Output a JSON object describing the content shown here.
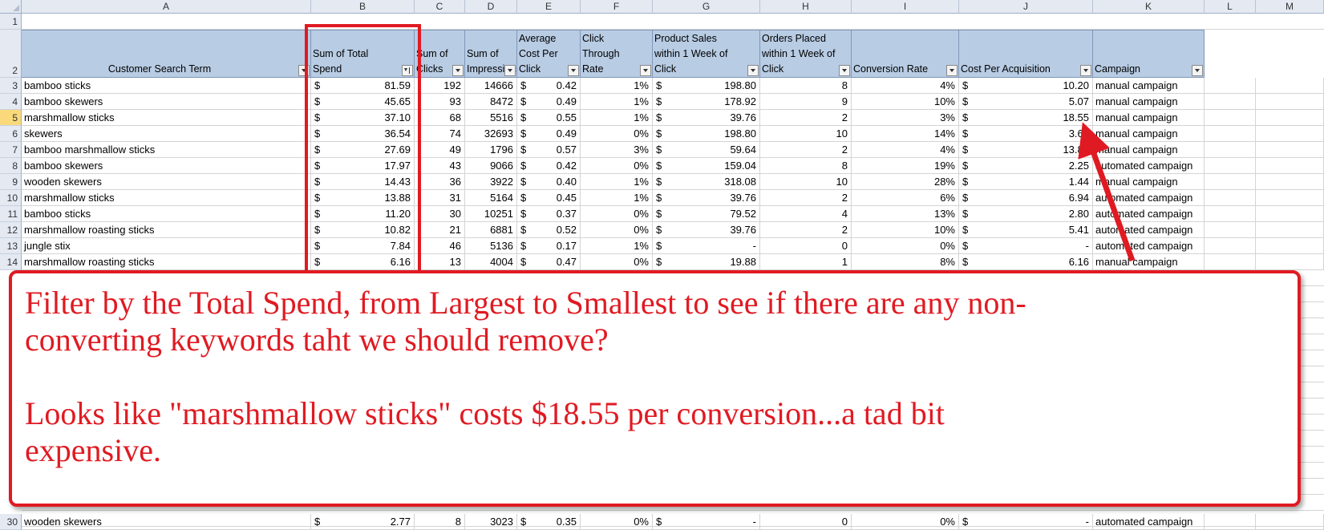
{
  "colors": {
    "annotation_red": "#e01a22",
    "header_fill": "#b8cce4",
    "selected_row": "#f9d97a"
  },
  "columns": [
    "A",
    "B",
    "C",
    "D",
    "E",
    "F",
    "G",
    "H",
    "I",
    "J",
    "K",
    "L",
    "M"
  ],
  "table": {
    "headers": [
      "Customer Search Term",
      "Sum of Total Spend",
      "Sum of Clicks",
      "Sum of Impressions",
      "Average Cost Per Click",
      "Click Through Rate",
      "Product Sales within 1 Week of Click",
      "Orders Placed within 1 Week of Click",
      "Conversion Rate",
      "Cost Per Acquisition",
      "Campaign"
    ],
    "currency_symbol": "$",
    "rows": [
      {
        "row": "3",
        "term": "bamboo sticks",
        "spend": "81.59",
        "clicks": "192",
        "impr": "14666",
        "cpc": "0.42",
        "ctr": "1%",
        "sales": "198.80",
        "orders": "8",
        "conv": "4%",
        "cpa": "10.20",
        "campaign": "manual campaign"
      },
      {
        "row": "4",
        "term": "bamboo skewers",
        "spend": "45.65",
        "clicks": "93",
        "impr": "8472",
        "cpc": "0.49",
        "ctr": "1%",
        "sales": "178.92",
        "orders": "9",
        "conv": "10%",
        "cpa": "5.07",
        "campaign": "manual campaign"
      },
      {
        "row": "5",
        "term": "marshmallow sticks",
        "spend": "37.10",
        "clicks": "68",
        "impr": "5516",
        "cpc": "0.55",
        "ctr": "1%",
        "sales": "39.76",
        "orders": "2",
        "conv": "3%",
        "cpa": "18.55",
        "campaign": "manual campaign"
      },
      {
        "row": "6",
        "term": "skewers",
        "spend": "36.54",
        "clicks": "74",
        "impr": "32693",
        "cpc": "0.49",
        "ctr": "0%",
        "sales": "198.80",
        "orders": "10",
        "conv": "14%",
        "cpa": "3.65",
        "campaign": "manual campaign"
      },
      {
        "row": "7",
        "term": "bamboo marshmallow sticks",
        "spend": "27.69",
        "clicks": "49",
        "impr": "1796",
        "cpc": "0.57",
        "ctr": "3%",
        "sales": "59.64",
        "orders": "2",
        "conv": "4%",
        "cpa": "13.85",
        "campaign": "manual campaign"
      },
      {
        "row": "8",
        "term": "bamboo skewers",
        "spend": "17.97",
        "clicks": "43",
        "impr": "9066",
        "cpc": "0.42",
        "ctr": "0%",
        "sales": "159.04",
        "orders": "8",
        "conv": "19%",
        "cpa": "2.25",
        "campaign": "automated campaign"
      },
      {
        "row": "9",
        "term": "wooden skewers",
        "spend": "14.43",
        "clicks": "36",
        "impr": "3922",
        "cpc": "0.40",
        "ctr": "1%",
        "sales": "318.08",
        "orders": "10",
        "conv": "28%",
        "cpa": "1.44",
        "campaign": "manual campaign"
      },
      {
        "row": "10",
        "term": "marshmallow sticks",
        "spend": "13.88",
        "clicks": "31",
        "impr": "5164",
        "cpc": "0.45",
        "ctr": "1%",
        "sales": "39.76",
        "orders": "2",
        "conv": "6%",
        "cpa": "6.94",
        "campaign": "automated campaign"
      },
      {
        "row": "11",
        "term": "bamboo sticks",
        "spend": "11.20",
        "clicks": "30",
        "impr": "10251",
        "cpc": "0.37",
        "ctr": "0%",
        "sales": "79.52",
        "orders": "4",
        "conv": "13%",
        "cpa": "2.80",
        "campaign": "automated campaign"
      },
      {
        "row": "12",
        "term": "marshmallow roasting sticks",
        "spend": "10.82",
        "clicks": "21",
        "impr": "6881",
        "cpc": "0.52",
        "ctr": "0%",
        "sales": "39.76",
        "orders": "2",
        "conv": "10%",
        "cpa": "5.41",
        "campaign": "automated campaign"
      },
      {
        "row": "13",
        "term": "jungle stix",
        "spend": "7.84",
        "clicks": "46",
        "impr": "5136",
        "cpc": "0.17",
        "ctr": "1%",
        "sales": "-",
        "orders": "0",
        "conv": "0%",
        "cpa": "-",
        "campaign": "automated campaign"
      },
      {
        "row": "14",
        "term": "marshmallow roasting sticks",
        "spend": "6.16",
        "clicks": "13",
        "impr": "4004",
        "cpc": "0.47",
        "ctr": "0%",
        "sales": "19.88",
        "orders": "1",
        "conv": "8%",
        "cpa": "6.16",
        "campaign": "manual campaign"
      }
    ],
    "last_row": {
      "row": "30",
      "term": "wooden skewers",
      "spend": "2.77",
      "clicks": "8",
      "impr": "3023",
      "cpc": "0.35",
      "ctr": "0%",
      "sales": "-",
      "orders": "0",
      "conv": "0%",
      "cpa": "-",
      "campaign": "automated campaign"
    },
    "row_headers_top": [
      "1",
      "2"
    ]
  },
  "callout": {
    "line1": "Filter by the Total Spend, from Largest to Smallest to see if there are any non-",
    "line2": "converting keywords taht we should remove?",
    "line3": "Looks like \"marshmallow sticks\" costs $18.55 per conversion...a tad bit",
    "line4": "expensive."
  }
}
